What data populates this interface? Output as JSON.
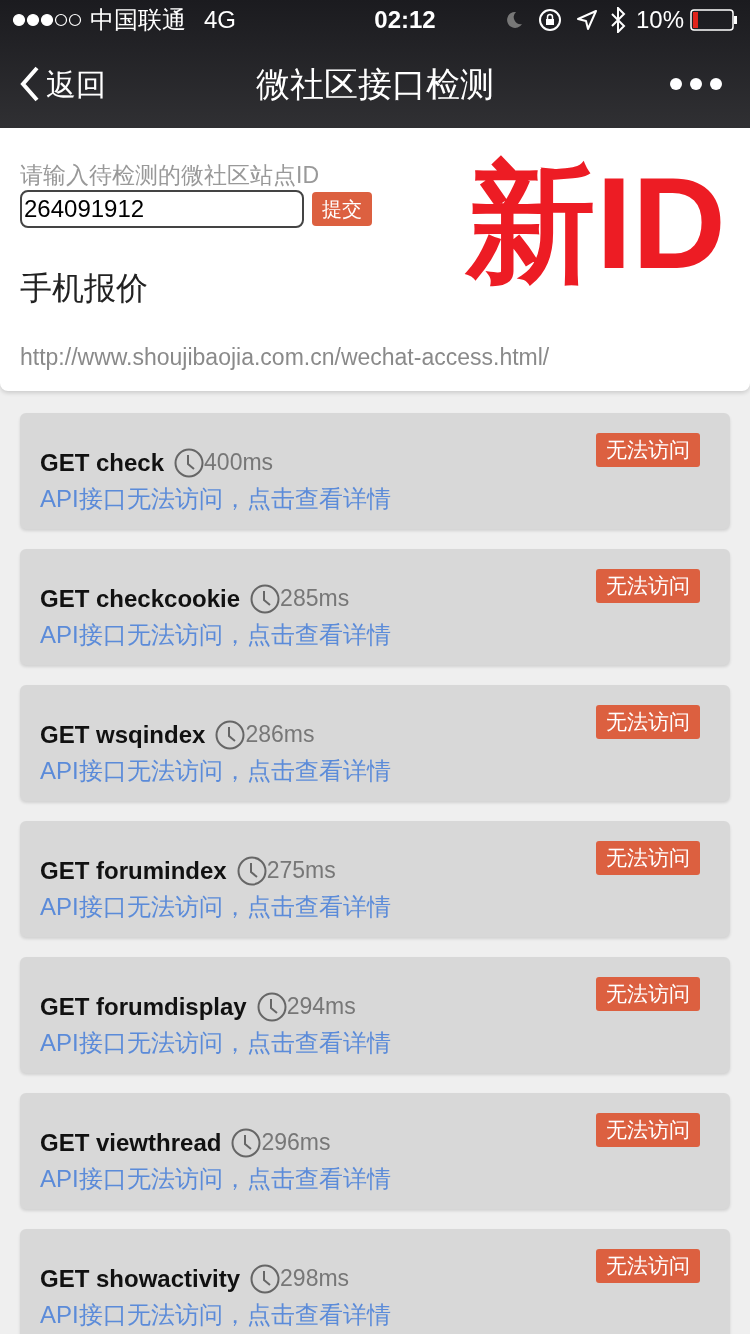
{
  "status_bar": {
    "carrier": "中国联通",
    "network": "4G",
    "time": "02:12",
    "battery": "10%"
  },
  "nav": {
    "back": "返回",
    "title": "微社区接口检测"
  },
  "form": {
    "label": "请输入待检测的微社区站点ID",
    "value": "264091912",
    "submit": "提交",
    "annotation": "新ID",
    "site_name": "手机报价",
    "site_url": "http://www.shoujibaojia.com.cn/wechat-access.html/"
  },
  "checks": [
    {
      "name": "GET check",
      "time": "400ms",
      "status": "无法访问",
      "message": "API接口无法访问，点击查看详情"
    },
    {
      "name": "GET checkcookie",
      "time": "285ms",
      "status": "无法访问",
      "message": "API接口无法访问，点击查看详情"
    },
    {
      "name": "GET wsqindex",
      "time": "286ms",
      "status": "无法访问",
      "message": "API接口无法访问，点击查看详情"
    },
    {
      "name": "GET forumindex",
      "time": "275ms",
      "status": "无法访问",
      "message": "API接口无法访问，点击查看详情"
    },
    {
      "name": "GET forumdisplay",
      "time": "294ms",
      "status": "无法访问",
      "message": "API接口无法访问，点击查看详情"
    },
    {
      "name": "GET viewthread",
      "time": "296ms",
      "status": "无法访问",
      "message": "API接口无法访问，点击查看详情"
    },
    {
      "name": "GET showactivity",
      "time": "298ms",
      "status": "无法访问",
      "message": "API接口无法访问，点击查看详情"
    }
  ]
}
